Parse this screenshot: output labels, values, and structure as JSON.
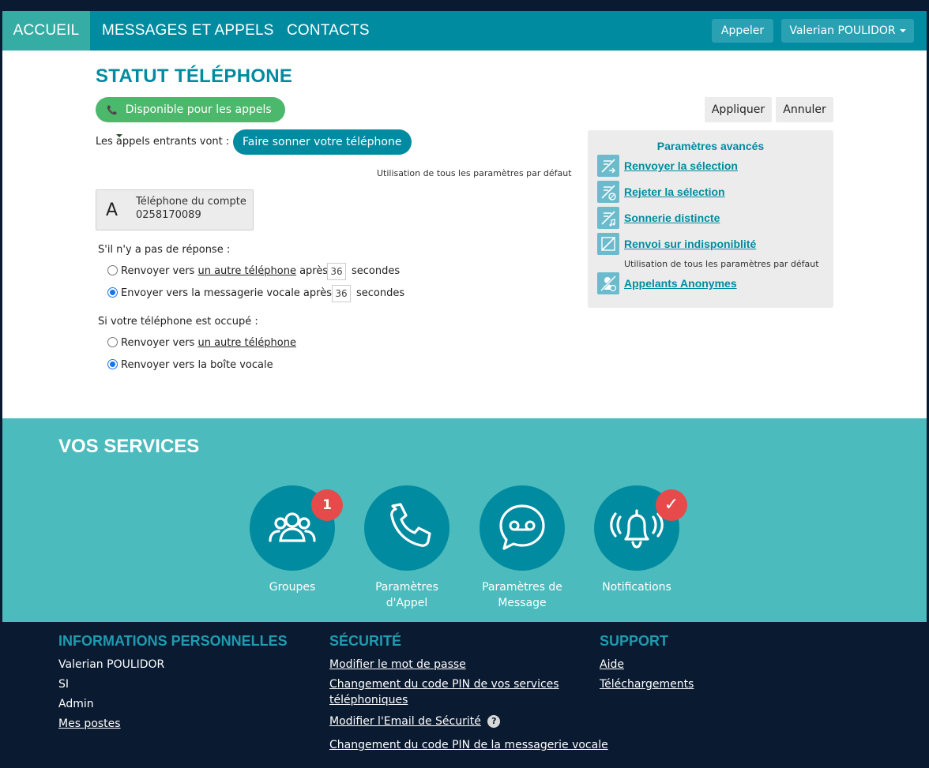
{
  "nav": {
    "items": [
      {
        "label": "ACCUEIL"
      },
      {
        "label": "MESSAGES ET APPELS"
      },
      {
        "label": "CONTACTS"
      }
    ],
    "call_button": "Appeler",
    "user_menu": "Valerian POULIDOR"
  },
  "status": {
    "title": "STATUT TÉLÉPHONE",
    "availability": "Disponible pour les appels",
    "apply_button": "Appliquer",
    "cancel_button": "Annuler",
    "incoming_label": "Les appels entrants vont :",
    "incoming_value": "Faire sonner votre téléphone",
    "default_note": "Utilisation de tous les paramètres par défaut",
    "account_letter": "A",
    "account_label": "Téléphone du compte",
    "account_number": "0258170089",
    "no_answer": {
      "label": "S'il n'y a pas de réponse :",
      "opt1_prefix": "Renvoyer vers",
      "opt1_link": "un autre téléphone",
      "opt1_after": "après",
      "opt1_seconds": "36",
      "opt1_unit": "secondes",
      "opt2_prefix": "Envoyer vers la messagerie vocale après",
      "opt2_seconds": "36",
      "opt2_unit": "secondes"
    },
    "busy": {
      "label": "Si votre téléphone est occupé :",
      "opt1_prefix": "Renvoyer vers",
      "opt1_link": "un autre téléphone",
      "opt2": "Renvoyer vers la boîte vocale"
    }
  },
  "advanced": {
    "title": "Paramètres avancés",
    "links": [
      {
        "label": "Renvoyer la sélection",
        "icon": "forward-selection-icon"
      },
      {
        "label": "Rejeter la sélection",
        "icon": "reject-selection-icon"
      },
      {
        "label": "Sonnerie distincte",
        "icon": "distinct-ring-icon"
      },
      {
        "label": "Renvoi sur indisponiblité",
        "icon": "unavailable-forward-icon"
      }
    ],
    "note": "Utilisation de tous les paramètres par défaut",
    "anon_link": "Appelants Anonymes"
  },
  "services": {
    "title": "VOS SERVICES",
    "items": [
      {
        "label": "Groupes",
        "badge": "1"
      },
      {
        "label_line1": "Paramètres",
        "label_line2": "d'Appel"
      },
      {
        "label_line1": "Paramètres de",
        "label_line2": "Message"
      },
      {
        "label": "Notifications",
        "badge": "✓"
      }
    ]
  },
  "footer": {
    "personal": {
      "heading": "INFORMATIONS PERSONNELLES",
      "name": "Valerian POULIDOR",
      "org": "SI",
      "role": "Admin",
      "link": "Mes postes"
    },
    "security": {
      "heading": "SÉCURITÉ",
      "link1": "Modifier le mot de passe",
      "link2_line1": "Changement du code PIN de vos services",
      "link2_line2": "téléphoniques",
      "link3": "Modifier l'Email de Sécurité",
      "link4": "Changement du code PIN de la messagerie vocale"
    },
    "support": {
      "heading": "SUPPORT",
      "link1": "Aide",
      "link2": "Téléchargements"
    }
  },
  "colors": {
    "primary": "#008ba0",
    "active_tab": "#35ada5",
    "available": "#4cb86b",
    "services_bg": "#4cbbbd",
    "footer_bg": "#0a1a30",
    "badge": "#e64a4a"
  }
}
